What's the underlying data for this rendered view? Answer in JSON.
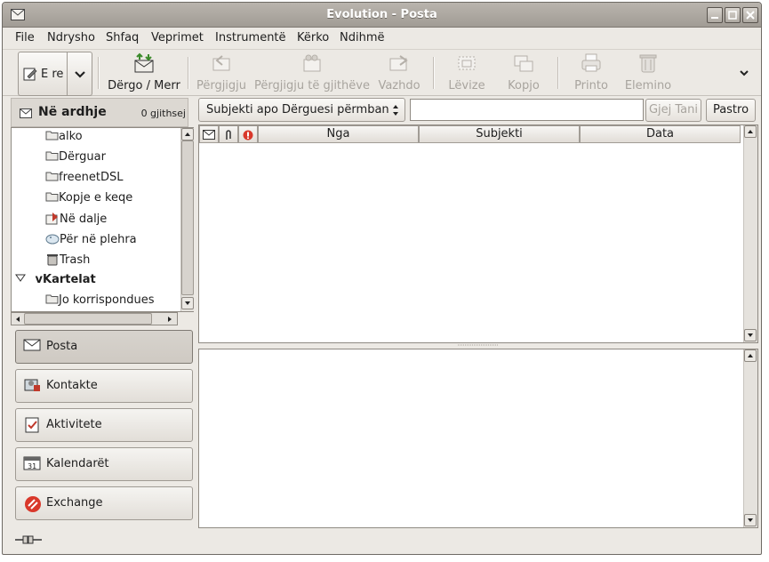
{
  "window": {
    "title": "Evolution - Posta"
  },
  "menu": [
    "File",
    "Ndrysho",
    "Shfaq",
    "Veprimet",
    "Instrumentë",
    "Kërko",
    "Ndihmë"
  ],
  "toolbar": {
    "new_label": "E re",
    "send_receive": "Dërgo / Merr",
    "reply": "Përgjigju",
    "reply_all": "Përgjigju të gjithëve",
    "forward": "Vazhdo",
    "move": "Lëvize",
    "copy": "Kopjo",
    "print": "Printo",
    "delete": "Elemino"
  },
  "folder_pane": {
    "header_title": "Në ardhje",
    "header_count": "0 gjithsej",
    "items": [
      {
        "label": "alko",
        "icon": "folder-icon"
      },
      {
        "label": "Dërguar",
        "icon": "folder-icon"
      },
      {
        "label": "freenetDSL",
        "icon": "folder-icon"
      },
      {
        "label": "Kopje e keqe",
        "icon": "folder-icon"
      },
      {
        "label": "Në dalje",
        "icon": "outbox-icon"
      },
      {
        "label": "Për në plehra",
        "icon": "junk-icon"
      },
      {
        "label": "Trash",
        "icon": "trash-icon"
      },
      {
        "label": "vKartelat",
        "icon": "expander-icon"
      },
      {
        "label": "Jo korrispondues",
        "icon": "folder-icon"
      }
    ]
  },
  "switcher": [
    "Posta",
    "Kontakte",
    "Aktivitete",
    "Kalendarët",
    "Exchange"
  ],
  "search": {
    "scope": "Subjekti apo Dërguesi përmban",
    "value": "",
    "find_now": "Gjej Tani",
    "clear": "Pastro"
  },
  "message_list": {
    "columns": [
      "Nga",
      "Subjekti",
      "Data"
    ]
  },
  "colors": {
    "window_bg": "#ece9e4",
    "titlebar": "#a19c95",
    "disabled_text": "#a8a49e"
  }
}
